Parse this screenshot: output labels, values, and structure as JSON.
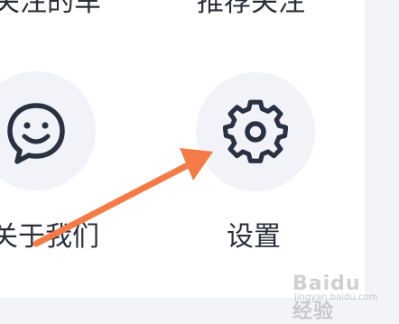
{
  "grid": {
    "top_row": {
      "left_label": "关注的车",
      "right_label": "推荐关注"
    },
    "items": [
      {
        "label": "关于我们",
        "icon": "smile-chat-icon"
      },
      {
        "label": "设置",
        "icon": "gear-icon"
      }
    ]
  },
  "annotation": {
    "arrow_color": "#f47b45"
  },
  "watermark": {
    "brand": "Baidu经验",
    "url": "jingyan.baidu.com"
  },
  "colors": {
    "background": "#f3f4f8",
    "card": "#ffffff",
    "icon_circle": "#f1f3f8",
    "icon_stroke": "#2a3142",
    "text": "#2a2f3a"
  }
}
